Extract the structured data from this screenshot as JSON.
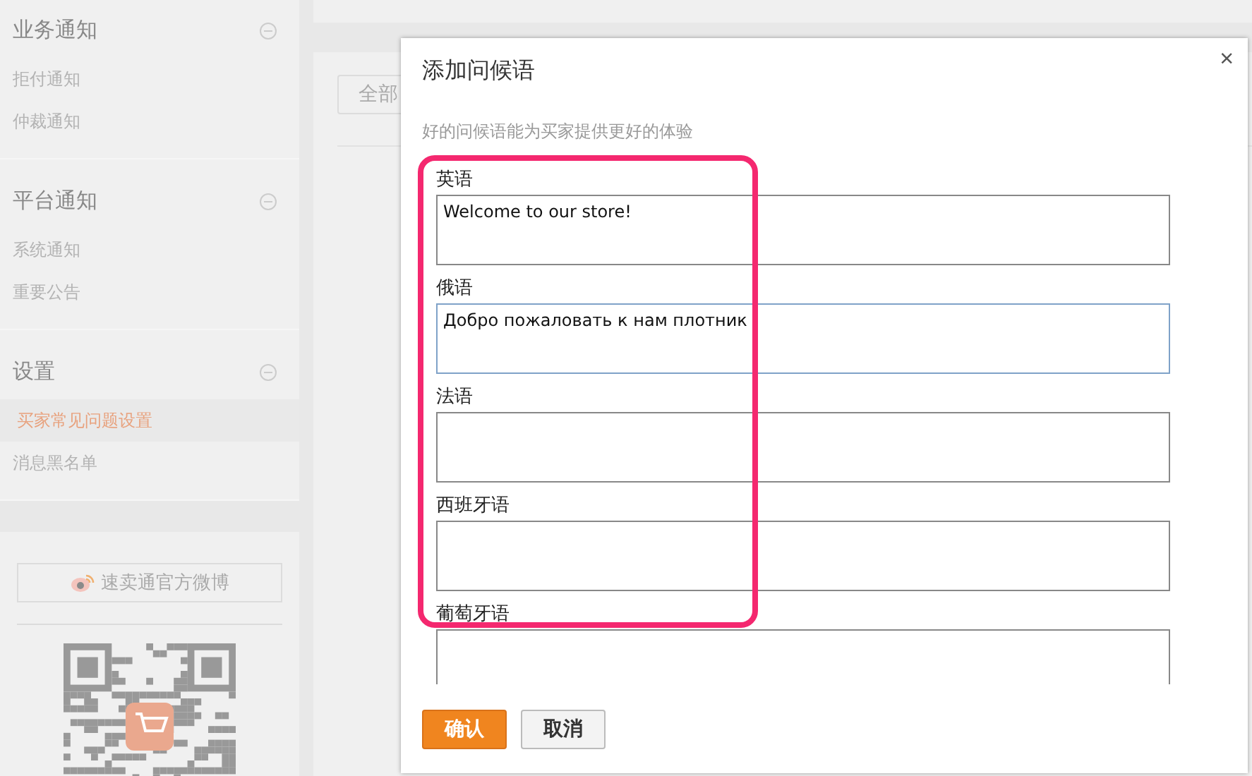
{
  "sidebar": {
    "sections": [
      {
        "title": "业务通知",
        "expanded": true,
        "items": [
          {
            "label": "拒付通知",
            "selected": false
          },
          {
            "label": "仲裁通知",
            "selected": false
          }
        ]
      },
      {
        "title": "平台通知",
        "expanded": true,
        "items": [
          {
            "label": "系统通知",
            "selected": false
          },
          {
            "label": "重要公告",
            "selected": false
          }
        ]
      },
      {
        "title": "设置",
        "expanded": true,
        "items": [
          {
            "label": "买家常见问题设置",
            "selected": true
          },
          {
            "label": "消息黑名单",
            "selected": false
          }
        ]
      }
    ],
    "weibo_button": "速卖通官方微博"
  },
  "main": {
    "filter_button": "全部"
  },
  "dialog": {
    "title": "添加问候语",
    "close": "×",
    "hint": "好的问候语能为买家提供更好的体验",
    "fields": [
      {
        "label": "英语",
        "value": "Welcome to our store!",
        "focused": false
      },
      {
        "label": "俄语",
        "value": "Добро пожаловать к нам плотник",
        "focused": true
      },
      {
        "label": "法语",
        "focused": false
      },
      {
        "label": "西班牙语",
        "focused": false
      },
      {
        "label": "葡萄牙语",
        "focused": false
      }
    ],
    "buttons": [
      {
        "label": "确认",
        "kind": "primary"
      },
      {
        "label": "取消",
        "kind": "secondary"
      }
    ]
  }
}
